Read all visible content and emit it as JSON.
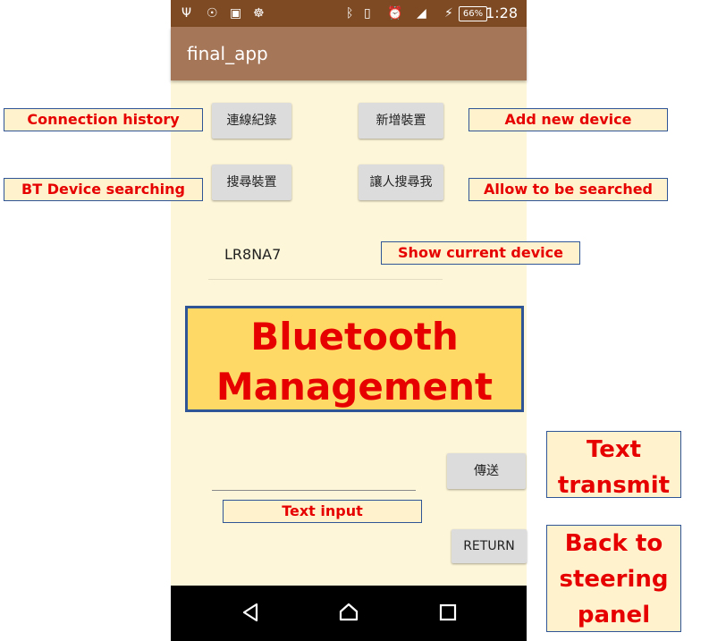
{
  "status_bar": {
    "battery": "66%",
    "time": "1:28",
    "icons": [
      "usb-icon",
      "bulb-icon",
      "image-icon",
      "android-icon",
      "bluetooth-icon",
      "vibrate-icon",
      "alarm-icon",
      "signal-icon",
      "charging-icon"
    ]
  },
  "app_bar": {
    "title": "final_app"
  },
  "buttons": {
    "connection_history": "連線紀錄",
    "add_device": "新增裝置",
    "search_devices": "搜尋裝置",
    "allow_discover": "讓人搜尋我",
    "send": "傳送",
    "return": "RETURN"
  },
  "device": {
    "name": "LR8NA7"
  },
  "text_input": {
    "value": "",
    "placeholder": ""
  },
  "annotations": {
    "connection_history": "Connection history",
    "add_new_device": "Add new device",
    "bt_device_searching": "BT Device searching",
    "allow_to_be_searched": "Allow to be searched",
    "show_current_device": "Show current device",
    "banner_line1": "Bluetooth",
    "banner_line2": "Management",
    "text_transmit_line1": "Text",
    "text_transmit_line2": "transmit",
    "text_input": "Text input",
    "back_line1": "Back to",
    "back_line2": "steering",
    "back_line3": "panel"
  },
  "colors": {
    "status_bar": "#7d4a23",
    "app_bar": "#a67658",
    "background": "#fef6d8",
    "annotation_text": "#e60000",
    "annotation_fill": "#fff2cc",
    "banner_fill": "#ffd966",
    "annotation_border": "#2f5597"
  }
}
